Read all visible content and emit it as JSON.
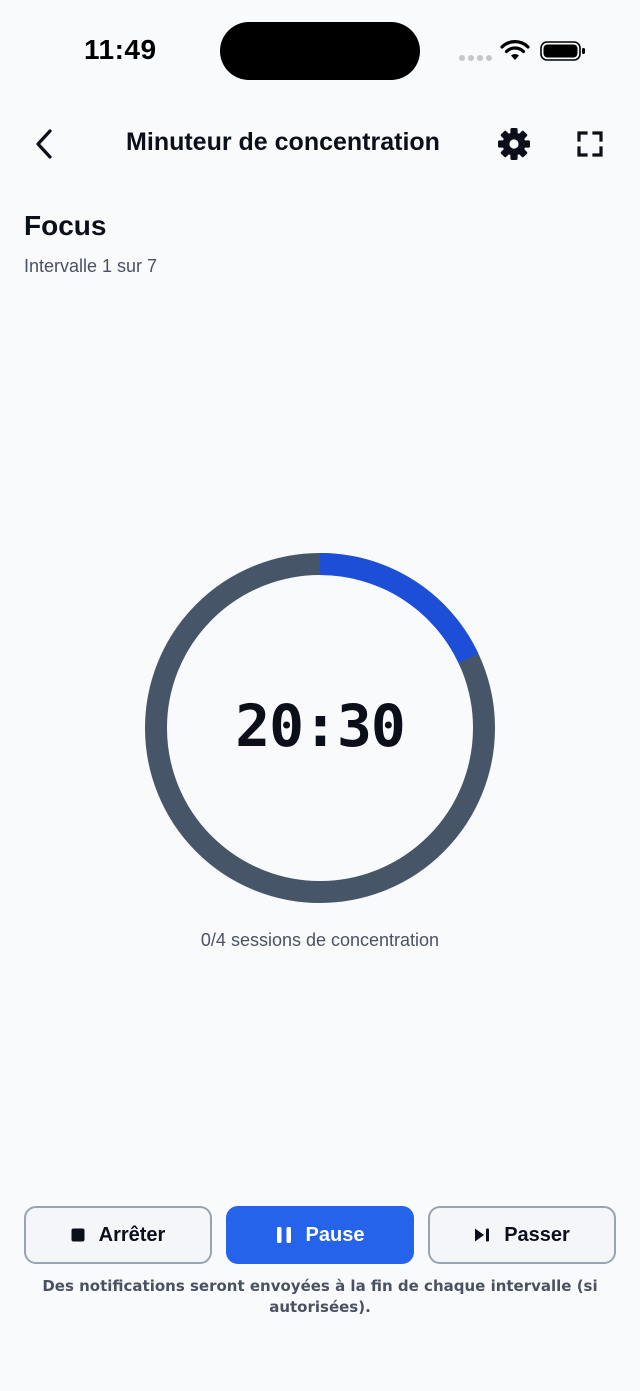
{
  "status_bar": {
    "time": "11:49"
  },
  "header": {
    "title": "Minuteur de concentration",
    "icons": {
      "back": "chevron-left-icon",
      "settings": "gear-icon",
      "fullscreen": "fullscreen-icon"
    }
  },
  "interval": {
    "phase": "Focus",
    "subtitle": "Intervalle 1 sur 7"
  },
  "timer": {
    "time": "20:30",
    "progress": 0.18,
    "track_color": "#475569",
    "progress_color": "#1d4ed8"
  },
  "sessions": {
    "text": "0/4 sessions de concentration"
  },
  "controls": {
    "stop_label": "Arrêter",
    "pause_label": "Pause",
    "skip_label": "Passer",
    "accent_color": "#2563eb"
  },
  "footnote": "Des notifications seront envoyées à la fin de chaque intervalle (si autorisées)."
}
